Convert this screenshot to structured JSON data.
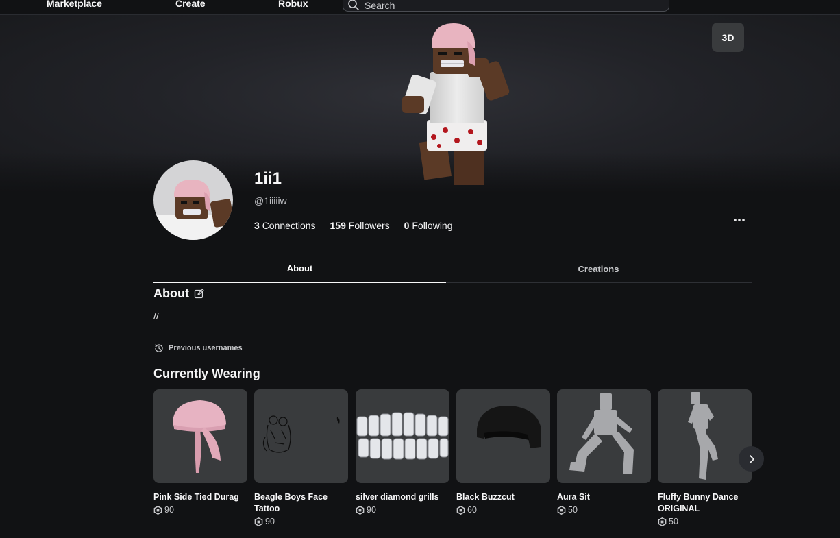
{
  "nav": {
    "links": [
      "Marketplace",
      "Create",
      "Robux"
    ],
    "search_placeholder": "Search"
  },
  "hero": {
    "view_toggle_label": "3D"
  },
  "profile": {
    "display_name": "1ii1",
    "username": "@1iiiiiw",
    "stats": [
      {
        "count": "3",
        "label": "Connections"
      },
      {
        "count": "159",
        "label": "Followers"
      },
      {
        "count": "0",
        "label": "Following"
      }
    ]
  },
  "tabs": [
    {
      "label": "About",
      "active": true
    },
    {
      "label": "Creations",
      "active": false
    }
  ],
  "about": {
    "title": "About",
    "text": "//",
    "previous_usernames_label": "Previous usernames"
  },
  "currently_wearing": {
    "title": "Currently Wearing",
    "items": [
      {
        "name": "Pink Side Tied Durag",
        "price": "90"
      },
      {
        "name": "Beagle Boys Face Tattoo",
        "price": "90"
      },
      {
        "name": "silver diamond grills",
        "price": "90"
      },
      {
        "name": "Black Buzzcut",
        "price": "60"
      },
      {
        "name": "Aura Sit",
        "price": "50"
      },
      {
        "name": "Fluffy Bunny Dance ORIGINAL",
        "price": "50"
      }
    ]
  },
  "colors": {
    "background": "#111214",
    "card": "#393b3d",
    "text": "#f7f7f8",
    "muted": "#c8c9cc"
  }
}
